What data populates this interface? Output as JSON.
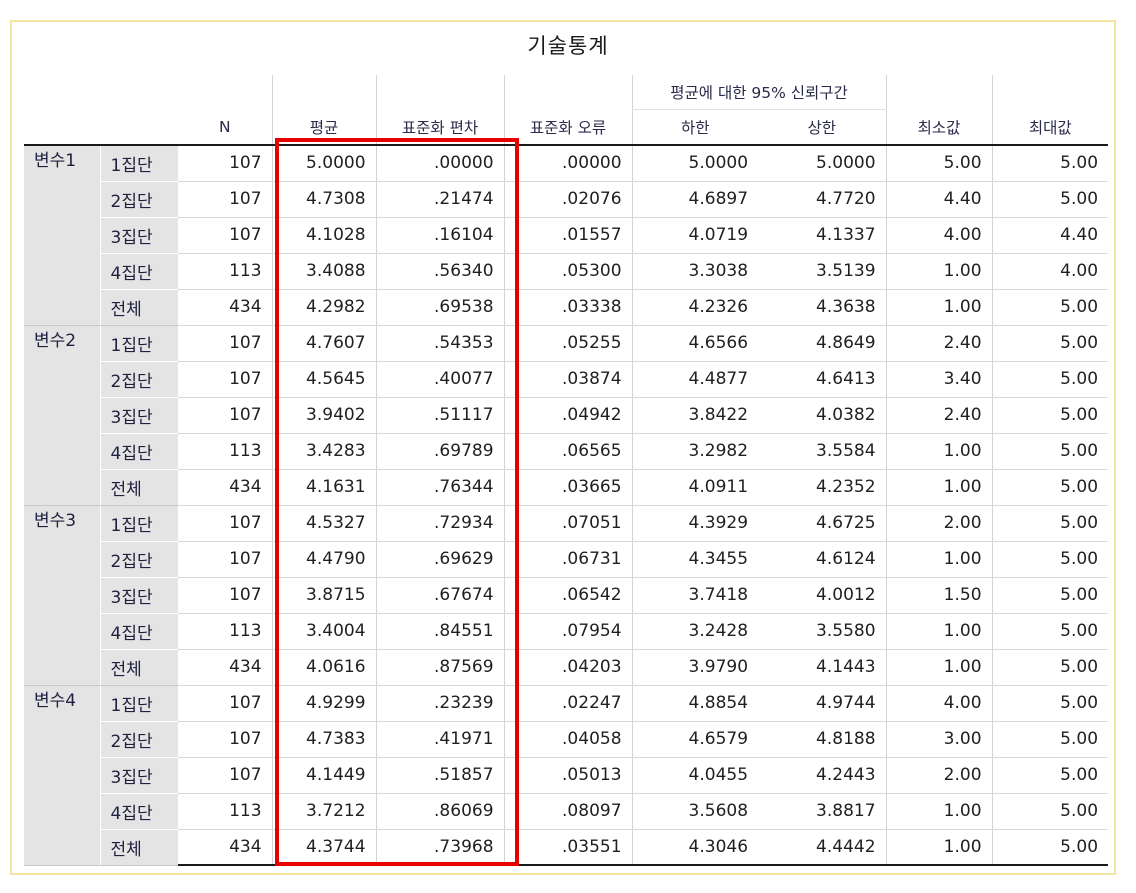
{
  "title": "기술통계",
  "headers": {
    "N": "N",
    "mean": "평균",
    "sd": "표준화 편차",
    "se": "표준화 오류",
    "ci_group": "평균에 대한 95% 신뢰구간",
    "lower": "하한",
    "upper": "상한",
    "min": "최소값",
    "max": "최대값"
  },
  "blocks": [
    {
      "variable": "변수1",
      "rows": [
        {
          "group": "1집단",
          "n": "107",
          "mean": "5.0000",
          "sd": ".00000",
          "se": ".00000",
          "lower": "5.0000",
          "upper": "5.0000",
          "min": "5.00",
          "max": "5.00"
        },
        {
          "group": "2집단",
          "n": "107",
          "mean": "4.7308",
          "sd": ".21474",
          "se": ".02076",
          "lower": "4.6897",
          "upper": "4.7720",
          "min": "4.40",
          "max": "5.00"
        },
        {
          "group": "3집단",
          "n": "107",
          "mean": "4.1028",
          "sd": ".16104",
          "se": ".01557",
          "lower": "4.0719",
          "upper": "4.1337",
          "min": "4.00",
          "max": "4.40"
        },
        {
          "group": "4집단",
          "n": "113",
          "mean": "3.4088",
          "sd": ".56340",
          "se": ".05300",
          "lower": "3.3038",
          "upper": "3.5139",
          "min": "1.00",
          "max": "4.00"
        },
        {
          "group": "전체",
          "n": "434",
          "mean": "4.2982",
          "sd": ".69538",
          "se": ".03338",
          "lower": "4.2326",
          "upper": "4.3638",
          "min": "1.00",
          "max": "5.00"
        }
      ]
    },
    {
      "variable": "변수2",
      "rows": [
        {
          "group": "1집단",
          "n": "107",
          "mean": "4.7607",
          "sd": ".54353",
          "se": ".05255",
          "lower": "4.6566",
          "upper": "4.8649",
          "min": "2.40",
          "max": "5.00"
        },
        {
          "group": "2집단",
          "n": "107",
          "mean": "4.5645",
          "sd": ".40077",
          "se": ".03874",
          "lower": "4.4877",
          "upper": "4.6413",
          "min": "3.40",
          "max": "5.00"
        },
        {
          "group": "3집단",
          "n": "107",
          "mean": "3.9402",
          "sd": ".51117",
          "se": ".04942",
          "lower": "3.8422",
          "upper": "4.0382",
          "min": "2.40",
          "max": "5.00"
        },
        {
          "group": "4집단",
          "n": "113",
          "mean": "3.4283",
          "sd": ".69789",
          "se": ".06565",
          "lower": "3.2982",
          "upper": "3.5584",
          "min": "1.00",
          "max": "5.00"
        },
        {
          "group": "전체",
          "n": "434",
          "mean": "4.1631",
          "sd": ".76344",
          "se": ".03665",
          "lower": "4.0911",
          "upper": "4.2352",
          "min": "1.00",
          "max": "5.00"
        }
      ]
    },
    {
      "variable": "변수3",
      "rows": [
        {
          "group": "1집단",
          "n": "107",
          "mean": "4.5327",
          "sd": ".72934",
          "se": ".07051",
          "lower": "4.3929",
          "upper": "4.6725",
          "min": "2.00",
          "max": "5.00"
        },
        {
          "group": "2집단",
          "n": "107",
          "mean": "4.4790",
          "sd": ".69629",
          "se": ".06731",
          "lower": "4.3455",
          "upper": "4.6124",
          "min": "1.00",
          "max": "5.00"
        },
        {
          "group": "3집단",
          "n": "107",
          "mean": "3.8715",
          "sd": ".67674",
          "se": ".06542",
          "lower": "3.7418",
          "upper": "4.0012",
          "min": "1.50",
          "max": "5.00"
        },
        {
          "group": "4집단",
          "n": "113",
          "mean": "3.4004",
          "sd": ".84551",
          "se": ".07954",
          "lower": "3.2428",
          "upper": "3.5580",
          "min": "1.00",
          "max": "5.00"
        },
        {
          "group": "전체",
          "n": "434",
          "mean": "4.0616",
          "sd": ".87569",
          "se": ".04203",
          "lower": "3.9790",
          "upper": "4.1443",
          "min": "1.00",
          "max": "5.00"
        }
      ]
    },
    {
      "variable": "변수4",
      "rows": [
        {
          "group": "1집단",
          "n": "107",
          "mean": "4.9299",
          "sd": ".23239",
          "se": ".02247",
          "lower": "4.8854",
          "upper": "4.9744",
          "min": "4.00",
          "max": "5.00"
        },
        {
          "group": "2집단",
          "n": "107",
          "mean": "4.7383",
          "sd": ".41971",
          "se": ".04058",
          "lower": "4.6579",
          "upper": "4.8188",
          "min": "3.00",
          "max": "5.00"
        },
        {
          "group": "3집단",
          "n": "107",
          "mean": "4.1449",
          "sd": ".51857",
          "se": ".05013",
          "lower": "4.0455",
          "upper": "4.2443",
          "min": "2.00",
          "max": "5.00"
        },
        {
          "group": "4집단",
          "n": "113",
          "mean": "3.7212",
          "sd": ".86069",
          "se": ".08097",
          "lower": "3.5608",
          "upper": "3.8817",
          "min": "1.00",
          "max": "5.00"
        },
        {
          "group": "전체",
          "n": "434",
          "mean": "4.3744",
          "sd": ".73968",
          "se": ".03551",
          "lower": "4.3046",
          "upper": "4.4442",
          "min": "1.00",
          "max": "5.00"
        }
      ]
    }
  ],
  "colors": {
    "highlight": "#e60000",
    "frame": "#f3e4a0",
    "label_bg": "#e4e4e4"
  }
}
